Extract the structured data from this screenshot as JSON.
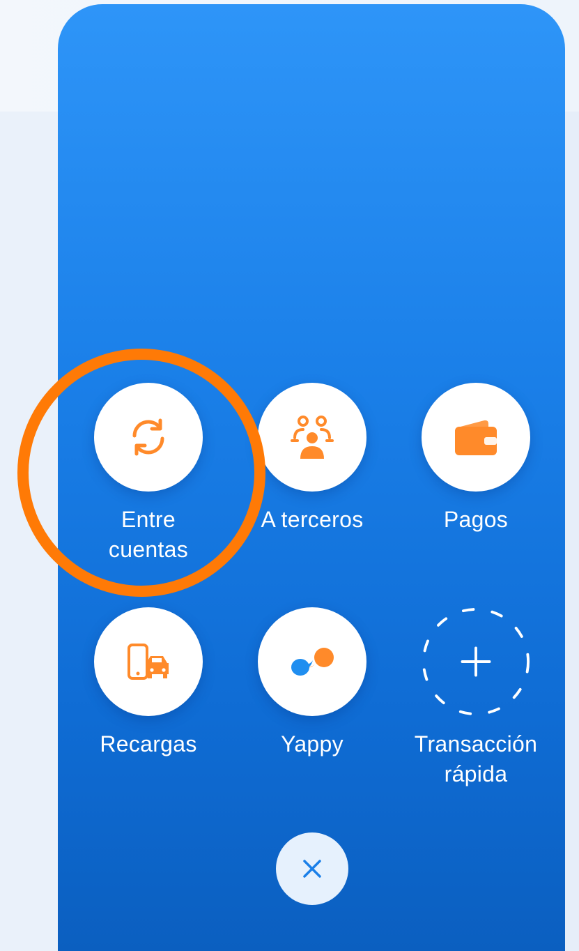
{
  "colors": {
    "panel_top": "#2e95f8",
    "panel_bottom": "#0b5fc0",
    "icon_accent": "#ff8a2a",
    "highlight_ring": "#ff7a06",
    "close_bg": "#e6f1fd",
    "close_icon": "#1a7fe8"
  },
  "actions": {
    "entre_cuentas": {
      "line1": "Entre",
      "line2": "cuentas",
      "icon": "refresh-arrows-icon"
    },
    "a_terceros": {
      "label": "A terceros",
      "icon": "people-group-icon"
    },
    "pagos": {
      "label": "Pagos",
      "icon": "wallet-icon"
    },
    "recargas": {
      "label": "Recargas",
      "icon": "phone-car-icon"
    },
    "yappy": {
      "label": "Yappy",
      "icon": "yappy-chat-bubbles-icon"
    },
    "transaccion_rapida": {
      "line1": "Transacción",
      "line2": "rápida",
      "icon": "plus-icon"
    }
  },
  "close": {
    "icon": "close-icon"
  }
}
